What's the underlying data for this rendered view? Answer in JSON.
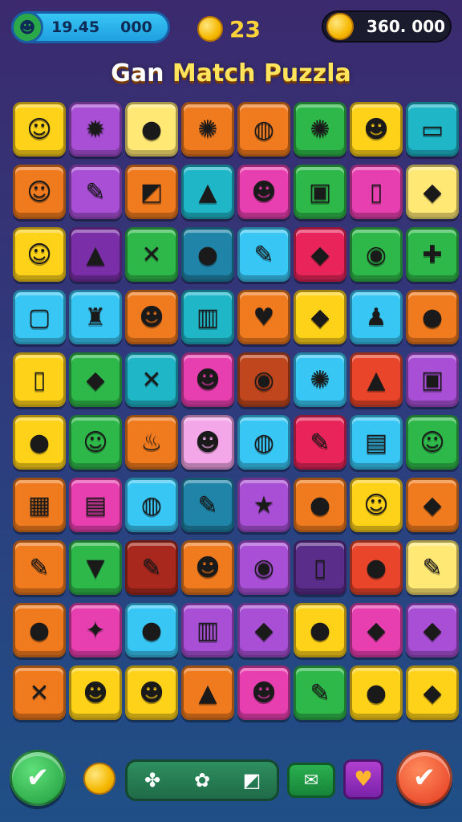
{
  "hud": {
    "left_value_a": "19.45",
    "left_value_b": "000",
    "center_value": "23",
    "right_value": "360. 000"
  },
  "title": {
    "first_word": "Gan",
    "rest": "Match Puzzla"
  },
  "tiles": [
    {
      "color": "#ffd21a",
      "icon": "☺",
      "name": "face"
    },
    {
      "color": "#a84fd6",
      "icon": "✹",
      "name": "sun"
    },
    {
      "color": "#ffe873",
      "icon": "●",
      "name": "apple"
    },
    {
      "color": "#f07a1e",
      "icon": "✺",
      "name": "virus"
    },
    {
      "color": "#f07a1e",
      "icon": "◍",
      "name": "bubble"
    },
    {
      "color": "#2fb84a",
      "icon": "✺",
      "name": "flower"
    },
    {
      "color": "#ffd21a",
      "icon": "☻",
      "name": "frog"
    },
    {
      "color": "#1fb6c8",
      "icon": "▭",
      "name": "screen"
    },
    {
      "color": "#f07a1e",
      "icon": "☺",
      "name": "face"
    },
    {
      "color": "#a84fd6",
      "icon": "✎",
      "name": "pencil"
    },
    {
      "color": "#f07a1e",
      "icon": "◩",
      "name": "tablet"
    },
    {
      "color": "#1fb6c8",
      "icon": "▲",
      "name": "tower"
    },
    {
      "color": "#e83fb0",
      "icon": "☻",
      "name": "bear"
    },
    {
      "color": "#2fb84a",
      "icon": "▣",
      "name": "frame"
    },
    {
      "color": "#e83fb0",
      "icon": "▯",
      "name": "phone"
    },
    {
      "color": "#ffe873",
      "icon": "◆",
      "name": "lemon"
    },
    {
      "color": "#ffd21a",
      "icon": "☺",
      "name": "face"
    },
    {
      "color": "#7a2fa8",
      "icon": "▲",
      "name": "bell"
    },
    {
      "color": "#2fb84a",
      "icon": "✕",
      "name": "crossed-sticks"
    },
    {
      "color": "#1f84a8",
      "icon": "●",
      "name": "plum"
    },
    {
      "color": "#38c6f4",
      "icon": "✎",
      "name": "cone"
    },
    {
      "color": "#e8245a",
      "icon": "◆",
      "name": "leaf"
    },
    {
      "color": "#2fb84a",
      "icon": "◉",
      "name": "donut"
    },
    {
      "color": "#2fb84a",
      "icon": "✚",
      "name": "gift"
    },
    {
      "color": "#38c6f4",
      "icon": "▢",
      "name": "tablet"
    },
    {
      "color": "#38c6f4",
      "icon": "♜",
      "name": "cake"
    },
    {
      "color": "#f07a1e",
      "icon": "☻",
      "name": "bear"
    },
    {
      "color": "#1fb6c8",
      "icon": "▥",
      "name": "building"
    },
    {
      "color": "#f07a1e",
      "icon": "♥",
      "name": "heart"
    },
    {
      "color": "#ffd21a",
      "icon": "◆",
      "name": "drop"
    },
    {
      "color": "#38c6f4",
      "icon": "♟",
      "name": "joystick"
    },
    {
      "color": "#f07a1e",
      "icon": "●",
      "name": "strawberry"
    },
    {
      "color": "#ffd21a",
      "icon": "▯",
      "name": "phone"
    },
    {
      "color": "#2fb84a",
      "icon": "◆",
      "name": "leaf"
    },
    {
      "color": "#1fb6c8",
      "icon": "✕",
      "name": "sticks"
    },
    {
      "color": "#e83fb0",
      "icon": "☻",
      "name": "robot"
    },
    {
      "color": "#c0461e",
      "icon": "◉",
      "name": "target"
    },
    {
      "color": "#38c6f4",
      "icon": "✺",
      "name": "flower"
    },
    {
      "color": "#e8452a",
      "icon": "▲",
      "name": "pear"
    },
    {
      "color": "#a84fd6",
      "icon": "▣",
      "name": "radio"
    },
    {
      "color": "#ffd21a",
      "icon": "●",
      "name": "apple"
    },
    {
      "color": "#2fb84a",
      "icon": "☺",
      "name": "cat"
    },
    {
      "color": "#f07a1e",
      "icon": "♨",
      "name": "bell"
    },
    {
      "color": "#f3a6e8",
      "icon": "☻",
      "name": "pig"
    },
    {
      "color": "#38c6f4",
      "icon": "◍",
      "name": "bubble"
    },
    {
      "color": "#e8245a",
      "icon": "✎",
      "name": "tools"
    },
    {
      "color": "#38c6f4",
      "icon": "▤",
      "name": "cup"
    },
    {
      "color": "#2fb84a",
      "icon": "☺",
      "name": "face"
    },
    {
      "color": "#f07a1e",
      "icon": "▦",
      "name": "panel"
    },
    {
      "color": "#e83fb0",
      "icon": "▤",
      "name": "book"
    },
    {
      "color": "#38c6f4",
      "icon": "◍",
      "name": "bubble"
    },
    {
      "color": "#1f84a8",
      "icon": "✎",
      "name": "marker"
    },
    {
      "color": "#a84fd6",
      "icon": "★",
      "name": "star"
    },
    {
      "color": "#f07a1e",
      "icon": "●",
      "name": "face"
    },
    {
      "color": "#ffd21a",
      "icon": "☺",
      "name": "face"
    },
    {
      "color": "#f07a1e",
      "icon": "◆",
      "name": "bean"
    },
    {
      "color": "#f07a1e",
      "icon": "✎",
      "name": "crayon"
    },
    {
      "color": "#2fb84a",
      "icon": "▼",
      "name": "cup"
    },
    {
      "color": "#a8281e",
      "icon": "✎",
      "name": "pen"
    },
    {
      "color": "#f07a1e",
      "icon": "☻",
      "name": "bomb"
    },
    {
      "color": "#a84fd6",
      "icon": "◉",
      "name": "compass"
    },
    {
      "color": "#5a2d8a",
      "icon": "▯",
      "name": "phone"
    },
    {
      "color": "#e8452a",
      "icon": "●",
      "name": "egg"
    },
    {
      "color": "#ffe873",
      "icon": "✎",
      "name": "crayon"
    },
    {
      "color": "#f07a1e",
      "icon": "●",
      "name": "apple"
    },
    {
      "color": "#e83fb0",
      "icon": "✦",
      "name": "sparkle"
    },
    {
      "color": "#38c6f4",
      "icon": "●",
      "name": "apple"
    },
    {
      "color": "#a84fd6",
      "icon": "▥",
      "name": "basket"
    },
    {
      "color": "#a84fd6",
      "icon": "◆",
      "name": "pear"
    },
    {
      "color": "#ffd21a",
      "icon": "●",
      "name": "pepper"
    },
    {
      "color": "#e83fb0",
      "icon": "◆",
      "name": "cheese"
    },
    {
      "color": "#a84fd6",
      "icon": "◆",
      "name": "leaf"
    },
    {
      "color": "#f07a1e",
      "icon": "✕",
      "name": "sticks"
    },
    {
      "color": "#ffd21a",
      "icon": "☻",
      "name": "sheep"
    },
    {
      "color": "#ffd21a",
      "icon": "☻",
      "name": "fox"
    },
    {
      "color": "#f07a1e",
      "icon": "▲",
      "name": "cone"
    },
    {
      "color": "#e83fb0",
      "icon": "☻",
      "name": "bear"
    },
    {
      "color": "#2fb84a",
      "icon": "✎",
      "name": "eraser"
    },
    {
      "color": "#ffd21a",
      "icon": "●",
      "name": "pepper"
    },
    {
      "color": "#ffd21a",
      "icon": "◆",
      "name": "plum"
    }
  ],
  "bottom": {
    "left_btn_icon": "✔",
    "right_btn_icon": "✔",
    "tool_icons": [
      "✤",
      "✿",
      "◩"
    ],
    "mail_icon": "✉",
    "heart_icon": "♥"
  }
}
